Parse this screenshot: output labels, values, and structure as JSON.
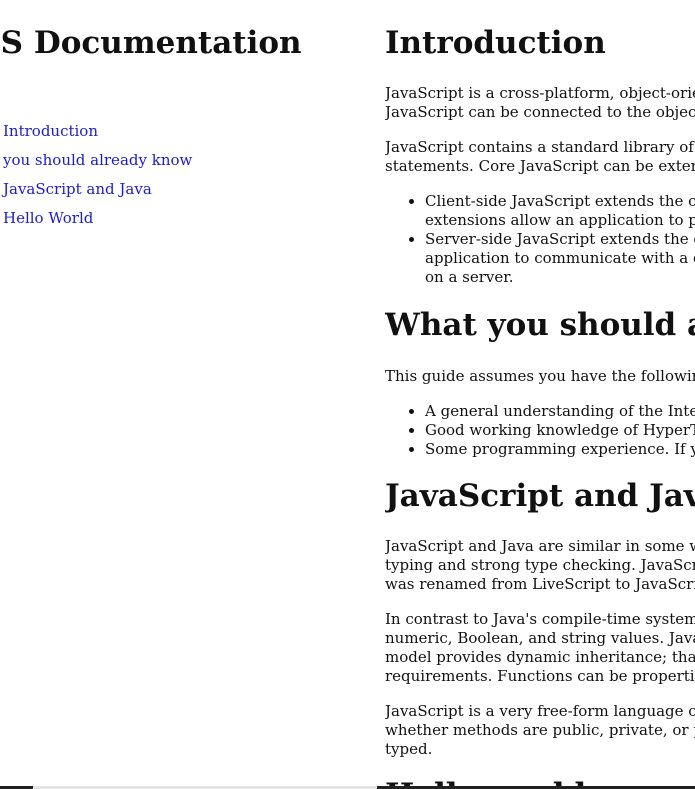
{
  "nav": {
    "title": "JS Documentation",
    "items": [
      {
        "label": "Introduction"
      },
      {
        "label": "you should already know"
      },
      {
        "label": "JavaScript and Java"
      },
      {
        "label": "Hello World"
      }
    ]
  },
  "sections": {
    "intro": {
      "heading": "Introduction",
      "p1_line1": "JavaScript is a cross-platform, object-oriented scripting language used to make webpages interactive (e.g.,",
      "p1_line2": "JavaScript can be connected to the objects of its environment to provide programmatic control over them.",
      "p2_line1": "JavaScript contains a standard library of objects, such as Array, Date, and Math, and a core set of language elements such as operators, control structures, and",
      "p2_line2": "statements. Core JavaScript can be extended for a variety of purposes by supplementing it with additional objects; for example:",
      "li1_line1": "Client-side JavaScript extends the core language by supplying objects to control a browser and its Document Object Model (DOM). For example, client-side",
      "li1_line2": "extensions allow an application to place elements on an HTML form and respond to user events such as mouse clicks, form input, and page navigation.",
      "li2_line1": "Server-side JavaScript extends the core language by supplying objects relevant to running JavaScript on a server. For example, server-side extensions allow an",
      "li2_line2": "application to communicate with a database, provide continuity of information from one invocation to another of the application, or perform file manipulations",
      "li2_line3": "on a server."
    },
    "know": {
      "heading": "What you should already know",
      "p1": "This guide assumes you have the following basic background:",
      "li1": "A general understanding of the Internet and the World Wide Web (WWW).",
      "li2": "Good working knowledge of HyperText Markup Language (HTML).",
      "li3": "Some programming experience. If you are new to programming, try one of the tutorials linked on the main page about JavaScript."
    },
    "java": {
      "heading": "JavaScript and Java",
      "p1_line1": "JavaScript and Java are similar in some ways but fundamentally different in some others. The JavaScript language resembles Java but does not have Java's static",
      "p1_line2": "typing and strong type checking. JavaScript follows most Java expression syntax, naming conventions and basic control-flow constructs which was the reason why it",
      "p1_line3": "was renamed from LiveScript to JavaScript.",
      "p2_line1": "In contrast to Java's compile-time system of classes built by declarations, JavaScript supports a runtime system based on a small number of data types representing",
      "p2_line2": "numeric, Boolean, and string values. JavaScript has a prototype-based object model instead of the more common class-based object model. The prototype-based",
      "p2_line3": "model provides dynamic inheritance; that is, what is inherited can vary for individual objects. JavaScript also supports functions without any special declarative",
      "p2_line4": "requirements. Functions can be properties of objects, executing as loosely typed methods.",
      "p3_line1": "JavaScript is a very free-form language compared to Java. You do not have to declare all variables, classes, and methods. You do not have to be concerned with",
      "p3_line2": "whether methods are public, private, or protected, and you do not have to implement interfaces. Variables, parameters, and function return types are not explicitly",
      "p3_line3": "typed."
    },
    "hello": {
      "heading": "Hello world"
    }
  }
}
